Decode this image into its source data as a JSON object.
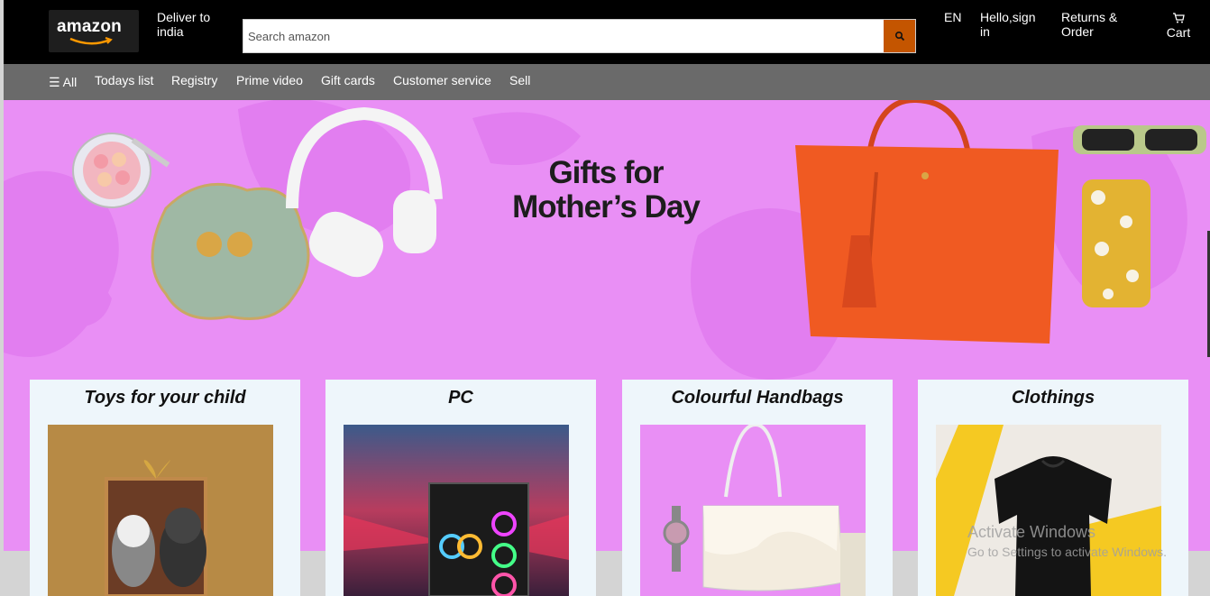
{
  "header": {
    "logo_text": "amazon",
    "deliver_line1": "Deliver to",
    "deliver_line2": "india",
    "search_placeholder": "Search amazon",
    "language": "EN",
    "account_line1": "Hello,sign",
    "account_line2": "in",
    "returns_line1": "Returns &",
    "returns_line2": "Order",
    "cart_label": "Cart"
  },
  "nav": {
    "items": [
      "☰ All",
      "Todays list",
      "Registry",
      "Prime video",
      "Gift cards",
      "Customer service",
      "Sell"
    ]
  },
  "banner": {
    "title_line1": "Gifts for",
    "title_line2": "Mother’s Day"
  },
  "cards": [
    {
      "title": "Toys for your child"
    },
    {
      "title": "PC"
    },
    {
      "title": "Colourful Handbags"
    },
    {
      "title": "Clothings"
    }
  ],
  "watermark": {
    "line1": "Activate Windows",
    "line2": "Go to Settings to activate Windows."
  },
  "colors": {
    "topbar": "#000000",
    "navbar": "#6a6a6a",
    "banner": "#e98ff5",
    "search_button": "#c45500",
    "card_bg": "#eef6fb"
  }
}
